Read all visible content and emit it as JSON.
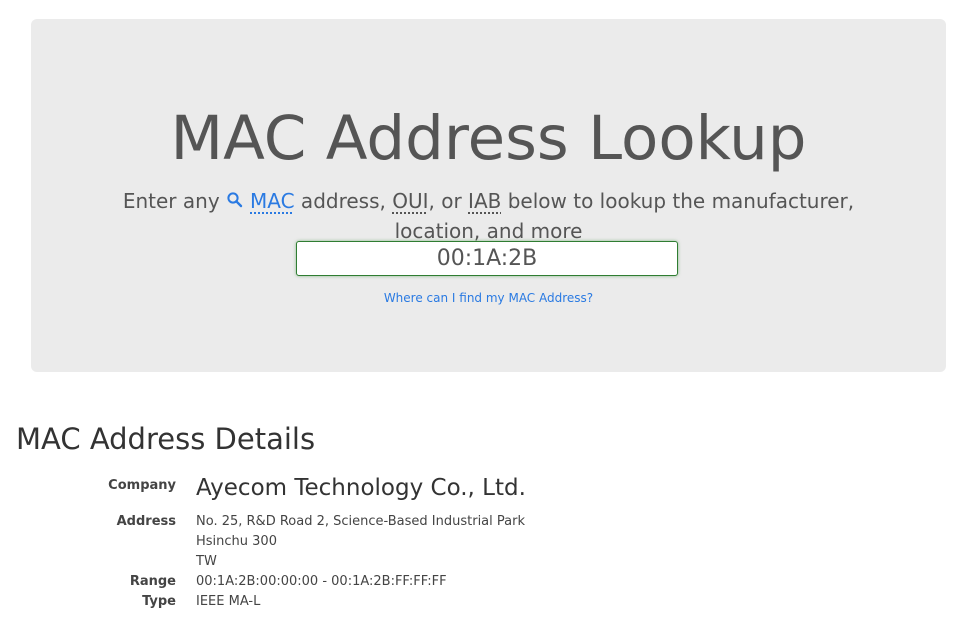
{
  "hero": {
    "title": "MAC Address Lookup",
    "subtitle_prefix": "Enter any",
    "mac_link": "MAC",
    "subtitle_mid1": " address, ",
    "oui": "OUI",
    "subtitle_mid2": ", or ",
    "iab": "IAB",
    "subtitle_suffix": " below to lookup the manufacturer, location, and more",
    "input_value": "00:1A:2B",
    "help_link": "Where can I find my MAC Address?"
  },
  "details": {
    "heading": "MAC Address Details",
    "company_label": "Company",
    "company_value": "Ayecom Technology Co., Ltd.",
    "address_label": "Address",
    "address_lines": [
      "No. 25, R&D Road 2, Science-Based Industrial Park",
      "Hsinchu 300",
      "TW"
    ],
    "range_label": "Range",
    "range_value": "00:1A:2B:00:00:00 - 00:1A:2B:FF:FF:FF",
    "type_label": "Type",
    "type_value": "IEEE MA-L"
  },
  "colors": {
    "jumbotron_bg": "#ebebeb",
    "link": "#2a7ae2",
    "input_border": "#2f7d32"
  }
}
